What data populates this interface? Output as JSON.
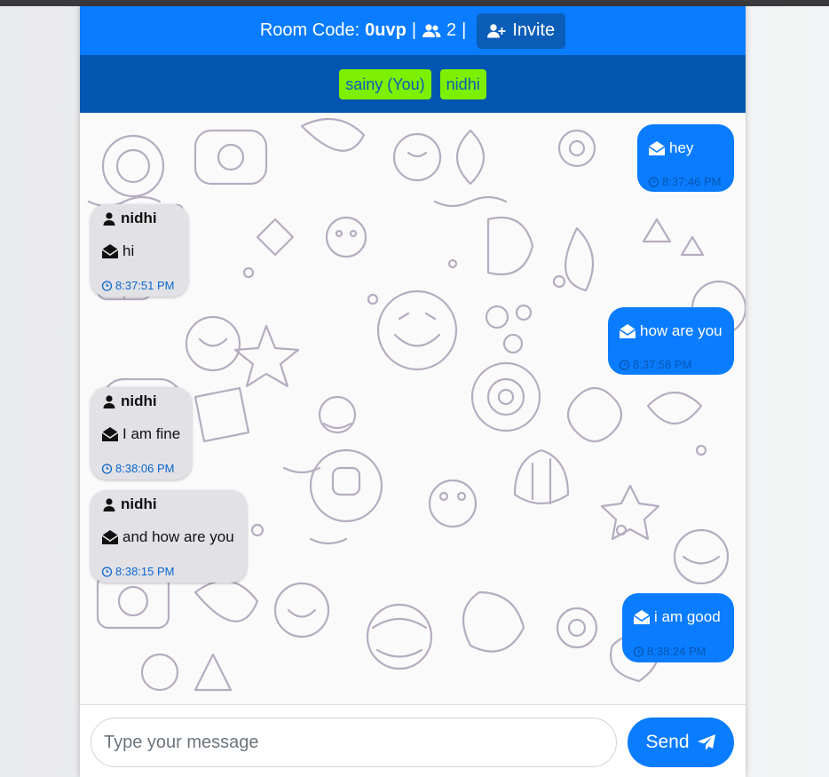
{
  "header": {
    "room_code_label": "Room Code:",
    "room_code": "0uvp",
    "separator": "|",
    "user_count": "2",
    "invite_label": "Invite"
  },
  "participants": [
    "sainy (You)",
    "nidhi"
  ],
  "messages": [
    {
      "type": "sent",
      "text": "hey",
      "time": "8:37:46 PM"
    },
    {
      "type": "received",
      "sender": "nidhi",
      "text": "hi",
      "time": "8:37:51 PM"
    },
    {
      "type": "sent",
      "text": "how are you",
      "time": "8:37:58 PM"
    },
    {
      "type": "received",
      "sender": "nidhi",
      "text": "I am fine",
      "time": "8:38:06 PM"
    },
    {
      "type": "received",
      "sender": "nidhi",
      "text": "and how are you",
      "time": "8:38:15 PM"
    },
    {
      "type": "sent",
      "text": "i am good",
      "time": "8:38:24 PM"
    }
  ],
  "composer": {
    "placeholder": "Type your message",
    "send_label": "Send"
  },
  "colors": {
    "header": "#0a7cff",
    "participants_bar": "#0556b0",
    "chip": "#7cf000",
    "sent_bubble": "#0a7cff",
    "received_bubble": "#e2e2e6"
  },
  "icons": [
    "users-icon",
    "user-plus-icon",
    "user-icon",
    "envelope-open-icon",
    "alarm-clock-icon",
    "paper-plane-icon"
  ]
}
